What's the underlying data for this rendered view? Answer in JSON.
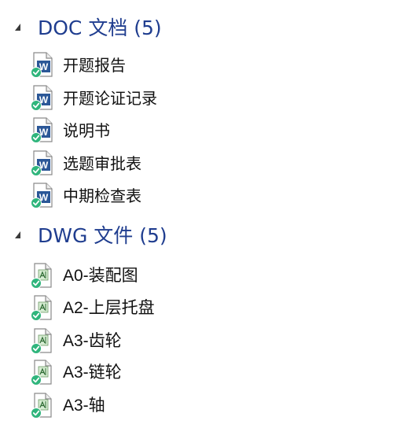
{
  "groups": [
    {
      "header": "DOC 文档 (5)",
      "type": "doc",
      "items": [
        {
          "label": "开题报告"
        },
        {
          "label": "开题论证记录"
        },
        {
          "label": "说明书"
        },
        {
          "label": "选题审批表"
        },
        {
          "label": "中期检查表"
        }
      ]
    },
    {
      "header": "DWG 文件 (5)",
      "type": "dwg",
      "items": [
        {
          "label": "A0-装配图"
        },
        {
          "label": "A2-上层托盘"
        },
        {
          "label": "A3-齿轮"
        },
        {
          "label": "A3-链轮"
        },
        {
          "label": "A3-轴"
        }
      ]
    }
  ],
  "icons": {
    "collapse": "collapse-arrow-icon",
    "doc": "word-document-icon",
    "dwg": "dwg-drawing-icon",
    "sync": "sync-check-icon"
  },
  "colors": {
    "header_text": "#1f3d8f",
    "item_text": "#111111",
    "word_blue": "#2b5797",
    "sync_green": "#2fb57c"
  }
}
